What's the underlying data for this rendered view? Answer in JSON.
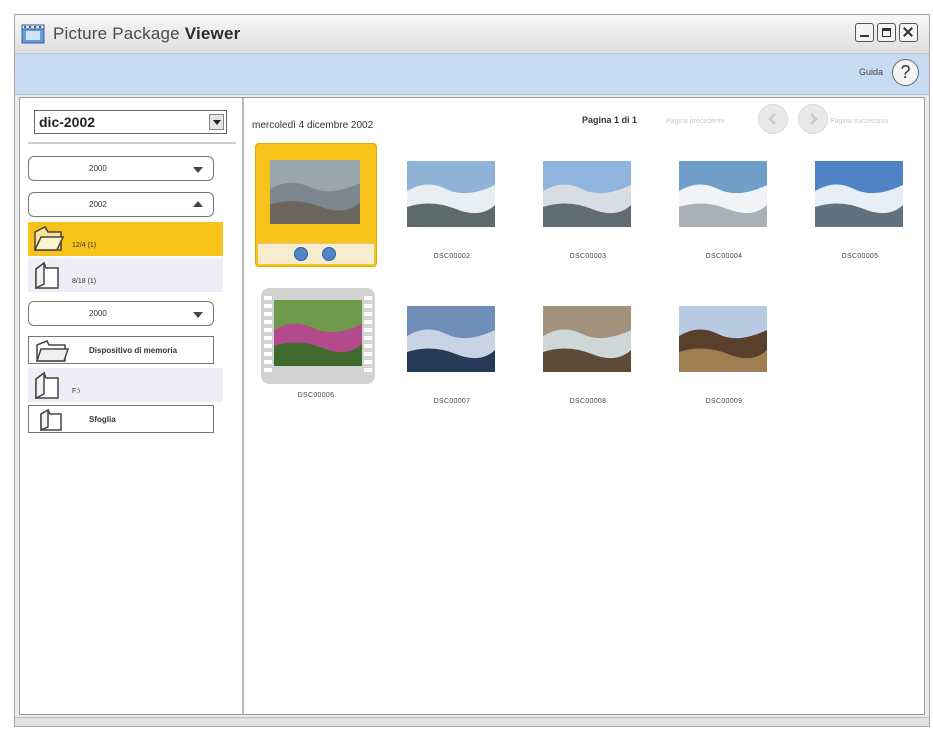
{
  "window": {
    "title_regular": "Picture Package ",
    "title_bold": "Viewer"
  },
  "toolbar": {
    "help_label": "Guida",
    "help_glyph": "?"
  },
  "sidebar": {
    "month_selected": "dic-2002",
    "years": [
      {
        "label": "2000",
        "expanded": false
      },
      {
        "label": "2002",
        "expanded": true
      },
      {
        "label": "2000",
        "expanded": false
      }
    ],
    "folders": [
      {
        "label": "12/4 (1)",
        "selected": true
      },
      {
        "label": "8/18 (1)",
        "selected": false
      }
    ],
    "memory_device": "Dispositivo di memoria",
    "drive_label": "F:\\",
    "browse_label": "Sfoglia"
  },
  "main": {
    "date_label": "mercoledì 4 dicembre 2002",
    "page_label": "Pagina 1 di 1",
    "prev_label": "Pagina precedente",
    "next_label": "Pagina successiva",
    "thumbnails": [
      {
        "caption": "",
        "kind": "selected",
        "palette": "mist"
      },
      {
        "caption": "DSC00002",
        "kind": "photo",
        "palette": "snow"
      },
      {
        "caption": "DSC00003",
        "kind": "photo",
        "palette": "snowpeaks"
      },
      {
        "caption": "DSC00004",
        "kind": "photo",
        "palette": "cloudy"
      },
      {
        "caption": "DSC00005",
        "kind": "photo",
        "palette": "valley"
      },
      {
        "caption": "DSC00006",
        "kind": "movie",
        "palette": "flowers"
      },
      {
        "caption": "DSC00007",
        "kind": "photo",
        "palette": "dusk"
      },
      {
        "caption": "DSC00008",
        "kind": "photo",
        "palette": "pond"
      },
      {
        "caption": "DSC00009",
        "kind": "photo",
        "palette": "trees"
      }
    ]
  },
  "colors": {
    "selection": "#f7c21a",
    "toolbar": "#c7dcf2"
  }
}
